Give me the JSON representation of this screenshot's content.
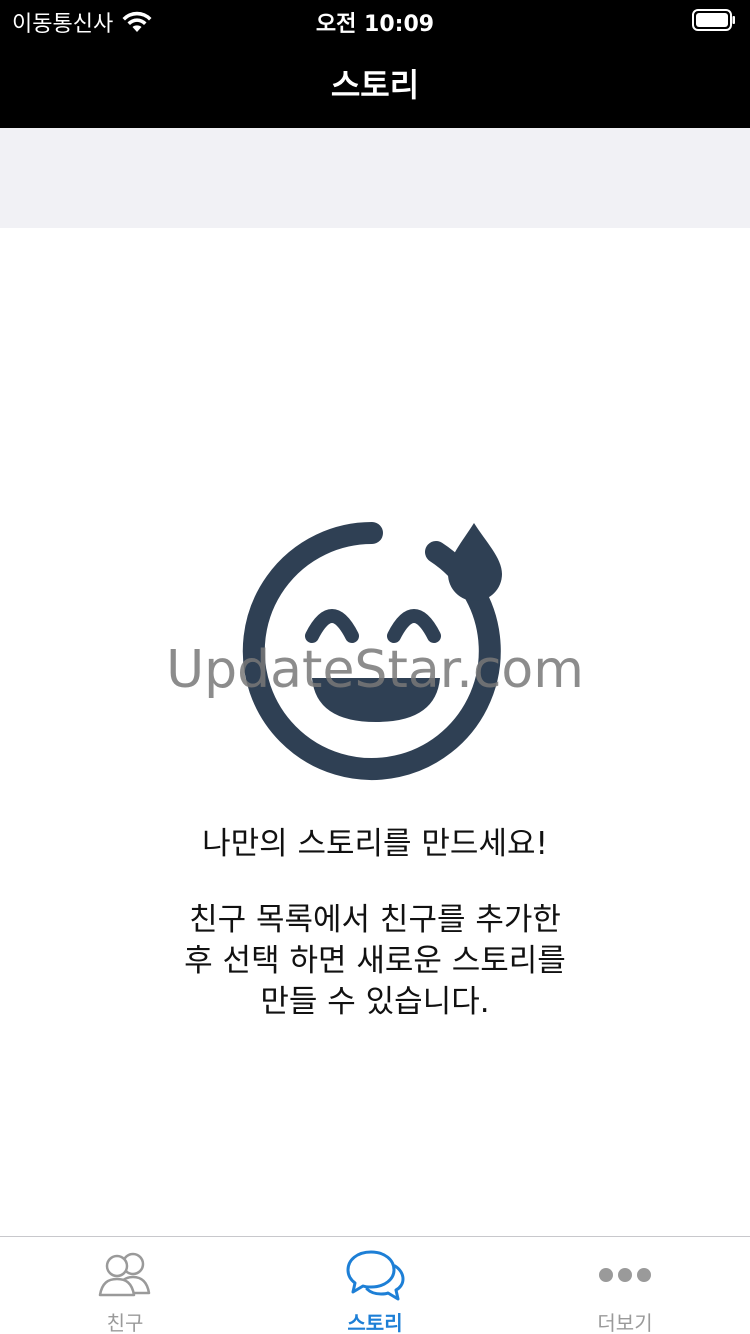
{
  "status_bar": {
    "carrier": "이동통신사",
    "time": "오전 10:09"
  },
  "nav": {
    "title": "스토리"
  },
  "empty_state": {
    "icon": "smiling-face-with-sweat-icon",
    "title": "나만의 스토리를 만드세요!",
    "description_lines": [
      "친구 목록에서 친구를 추가한",
      "후 선택 하면 새로운 스토리를",
      "만들 수 있습니다."
    ]
  },
  "watermark": "UpdateStar.com",
  "tabs": [
    {
      "label": "친구",
      "icon": "friends-icon",
      "active": false
    },
    {
      "label": "스토리",
      "icon": "chat-bubbles-icon",
      "active": true
    },
    {
      "label": "더보기",
      "icon": "more-icon",
      "active": false
    }
  ],
  "colors": {
    "header_bg": "#000000",
    "band_bg": "#f1f1f5",
    "icon_dark": "#2f4054",
    "active_tab": "#1d7fd6",
    "inactive_tab": "#9a9a9a"
  }
}
